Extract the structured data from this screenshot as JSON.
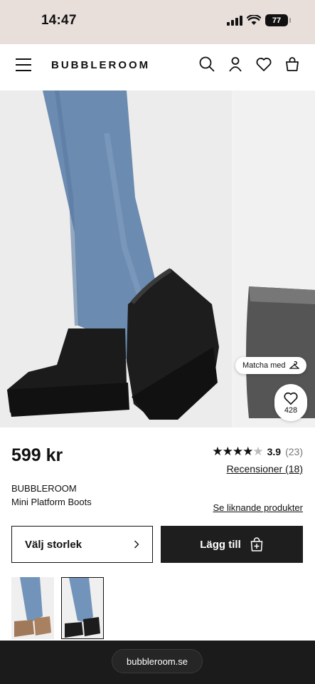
{
  "status_bar": {
    "time": "14:47",
    "battery": "77"
  },
  "header": {
    "logo": "BUBBLEROOM"
  },
  "gallery": {
    "match_label": "Matcha med",
    "favorites_count": "428",
    "dot_count": 4,
    "active_dot": 1
  },
  "product": {
    "price": "599 kr",
    "rating_value": "3.9",
    "rating_count": "(23)",
    "rating_stars": 3.9,
    "reviews_link": "Recensioner (18)",
    "brand": "BUBBLEROOM",
    "name": "Mini Platform Boots",
    "similar_link": "Se liknande produkter"
  },
  "actions": {
    "size_label": "Välj storlek",
    "add_label": "Lägg till"
  },
  "thumbnails": [
    {
      "alt": "chestnut boots variant"
    },
    {
      "alt": "black boots variant"
    }
  ],
  "browser": {
    "url": "bubbleroom.se"
  }
}
